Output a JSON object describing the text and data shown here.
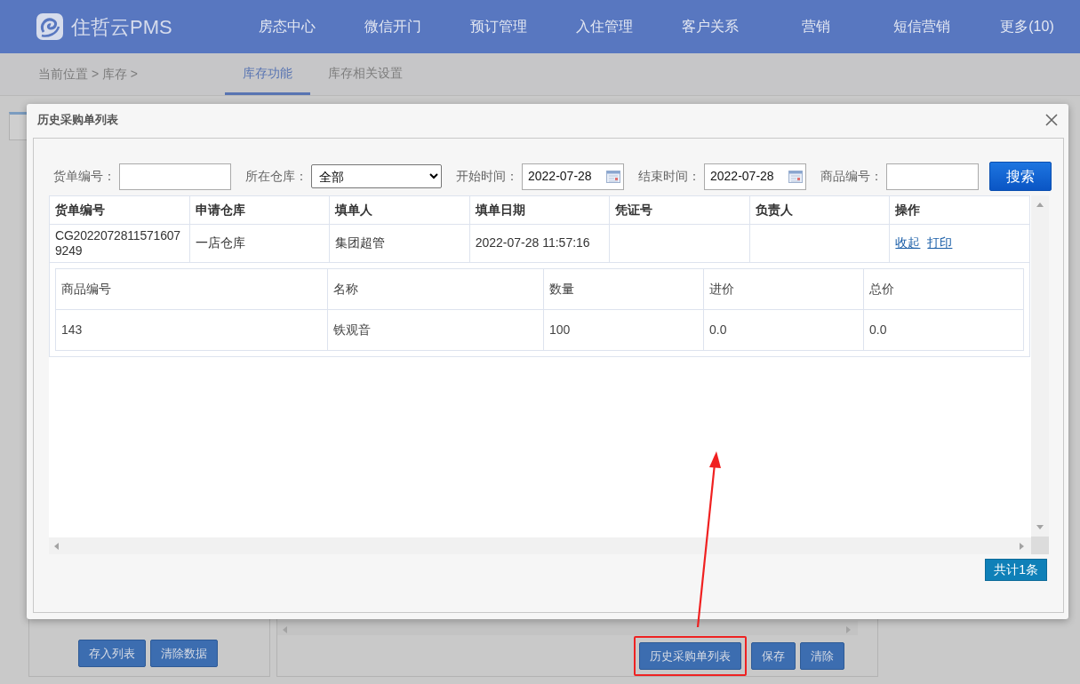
{
  "header": {
    "logo_text": "住哲云PMS",
    "nav": [
      "房态中心",
      "微信开门",
      "预订管理",
      "入住管理",
      "客户关系",
      "营销",
      "短信营销",
      "更多(10)"
    ]
  },
  "breadcrumb": "当前位置 > 库存 >",
  "page_tabs": [
    {
      "label": "库存功能",
      "selected": true
    },
    {
      "label": "库存相关设置",
      "selected": false
    }
  ],
  "modal": {
    "title": "历史采购单列表",
    "filters": [
      {
        "kind": "text",
        "label": "货单编号："
      },
      {
        "kind": "select",
        "label": "所在仓库：",
        "value": "全部"
      },
      {
        "kind": "date",
        "label": "开始时间：",
        "value": "2022-07-28"
      },
      {
        "kind": "date",
        "label": "结束时间：",
        "value": "2022-07-28"
      },
      {
        "kind": "text",
        "label": "商品编号："
      }
    ],
    "search_button": "搜索",
    "table": {
      "columns": [
        "货单编号",
        "申请仓库",
        "填单人",
        "填单日期",
        "凭证号",
        "负责人",
        "操作"
      ],
      "rows": [
        {
          "order_no": "CG20220728115716079249",
          "warehouse": "一店仓库",
          "filler": "集团超管",
          "date": "2022-07-28 11:57:16",
          "actions": [
            "收起",
            "打印"
          ],
          "expanded": true,
          "details": {
            "columns": [
              "商品编号",
              "名称",
              "数量",
              "进价",
              "总价"
            ],
            "rows": [
              [
                "143",
                "铁观音",
                "100",
                "0.0",
                "0.0"
              ]
            ]
          }
        }
      ]
    },
    "count": "共计1条"
  },
  "left_buttons": [
    "存入列表",
    "清除数据"
  ],
  "right_buttons": [
    {
      "label": "历史采购单列表",
      "highlighted": true
    },
    {
      "label": "保存",
      "highlighted": false
    },
    {
      "label": "清除",
      "highlighted": false
    }
  ]
}
